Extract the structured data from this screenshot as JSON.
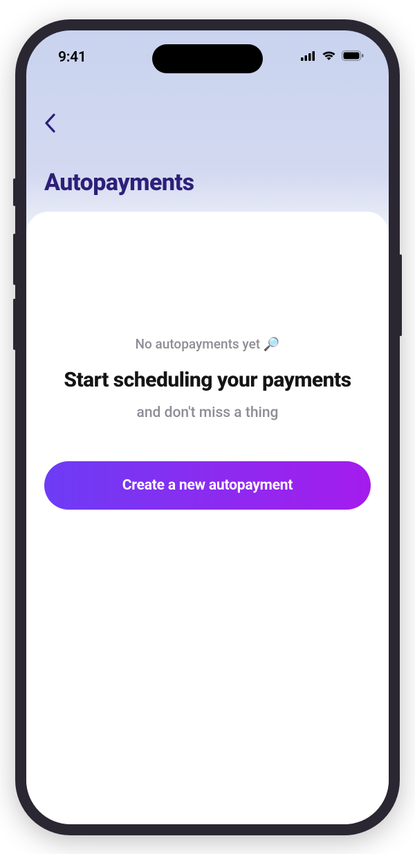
{
  "status": {
    "time": "9:41"
  },
  "page": {
    "title": "Autopayments"
  },
  "empty": {
    "label": "No autopayments yet 🔎",
    "heading": "Start scheduling your payments",
    "sub": "and don't miss a thing",
    "cta": "Create a new autopayment"
  }
}
